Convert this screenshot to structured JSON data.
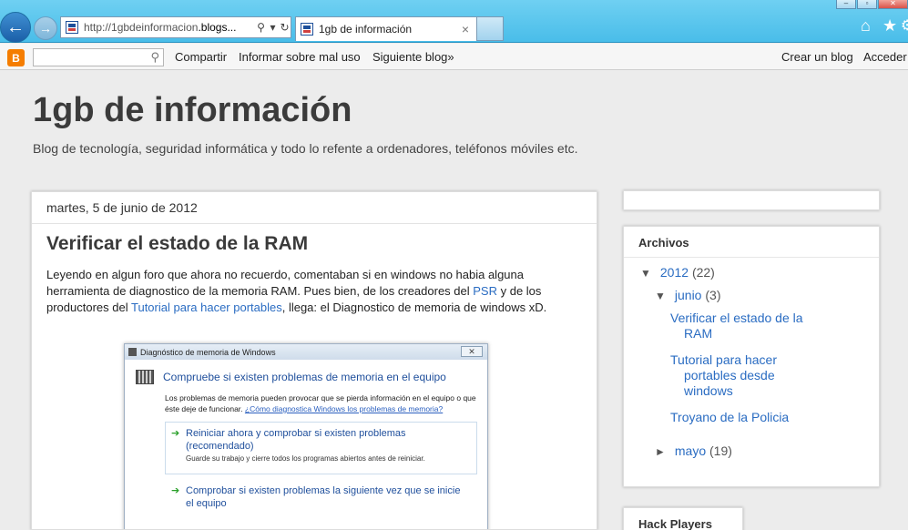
{
  "browser": {
    "address_prefix": "http://",
    "address_domain_start": "1gbdeinformacion",
    "address_domain_end": ".blogs...",
    "tab_title": "1gb de información",
    "tab_close": "×"
  },
  "navbar": {
    "search_value": "",
    "links": [
      "Compartir",
      "Informar sobre mal uso",
      "Siguiente blog»"
    ],
    "right_links": [
      "Crear un blog",
      "Acceder"
    ]
  },
  "header": {
    "title": "1gb de información",
    "description": "Blog de tecnología, seguridad informática y todo lo refente a ordenadores, teléfonos móviles etc."
  },
  "post": {
    "date": "martes, 5 de junio de 2012",
    "title": "Verificar el estado de la RAM",
    "body_part1": "Leyendo en algun foro que ahora no recuerdo, comentaban si en windows no habia alguna herramienta de diagnostico de la memoria RAM. Pues bien, de los creadores del ",
    "link1": "PSR",
    "body_part2": " y de los productores del ",
    "link2": "Tutorial para hacer portables",
    "body_part3": ", llega: el Diagnostico de memoria de windows xD."
  },
  "screenshot": {
    "window_title": "Diagnóstico de memoria de Windows",
    "heading": "Compruebe si existen problemas de memoria en el equipo",
    "desc": "Los problemas de memoria pueden provocar que se pierda información en el equipo o que éste deje de funcionar. ",
    "desc_link": "¿Cómo diagnostica Windows los problemas de memoria?",
    "option1_main": "Reiniciar ahora y comprobar si existen problemas (recomendado)",
    "option1_sub": "Guarde su trabajo y cierre todos los programas abiertos antes de reiniciar.",
    "option2_main": "Comprobar si existen problemas la siguiente vez que se inicie el equipo"
  },
  "sidebar": {
    "archive_title": "Archivos",
    "year": {
      "toggle": "▼",
      "label": "2012",
      "count": "(22)"
    },
    "month_open": {
      "toggle": "▼",
      "label": "junio",
      "count": "(3)"
    },
    "posts": [
      "Verificar el estado de la RAM",
      "Tutorial para hacer portables desde windows",
      "Troyano de la Policia"
    ],
    "month_closed": {
      "toggle": "►",
      "label": "mayo",
      "count": "(19)"
    },
    "next_widget_title": "Hack Players"
  },
  "colors": {
    "link": "#2a6cc2",
    "ie_bar": "#49bde9",
    "blogger_orange": "#f57d00"
  }
}
